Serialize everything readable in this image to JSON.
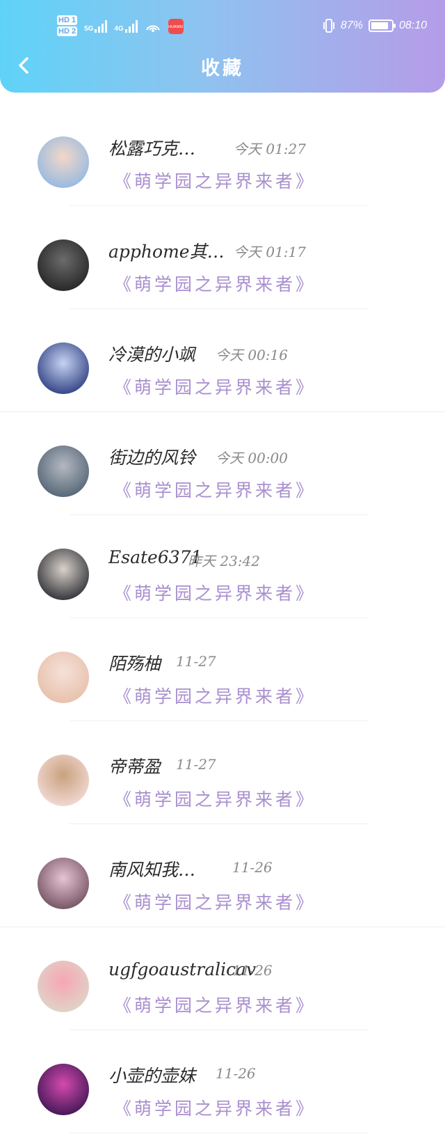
{
  "status_bar": {
    "hd1": "HD 1",
    "hd2": "HD 2",
    "net1": "5G",
    "net2": "4G",
    "app_badge": "HUAWEI",
    "battery_percent": "87%",
    "time": "08:10",
    "battery_level": 0.87
  },
  "header": {
    "title": "收藏"
  },
  "favorites": [
    {
      "name": "松露巧克…",
      "time": "今天 01:27",
      "work": "《萌学园之异界来者》",
      "avatar_colors": [
        "#9bbbe0",
        "#f3d8c8"
      ]
    },
    {
      "name": "apphome其…",
      "time": "今天 01:17",
      "work": "《萌学园之异界来者》",
      "avatar_colors": [
        "#2a2a2a",
        "#6b6b6b"
      ]
    },
    {
      "name": "冷漠的小飒",
      "time": "今天 00:16",
      "work": "《萌学园之异界来者》",
      "avatar_colors": [
        "#3a4a8a",
        "#c6d3f2"
      ]
    },
    {
      "name": "街边的风铃",
      "time": "今天 00:00",
      "work": "《萌学园之异界来者》",
      "avatar_colors": [
        "#5a6a7a",
        "#b4b9c2"
      ]
    },
    {
      "name": "Esate6371",
      "time": "昨天 23:42",
      "work": "《萌学园之异界来者》",
      "avatar_colors": [
        "#3b3b40",
        "#d9d2cb"
      ]
    },
    {
      "name": "陌殇柚",
      "time": "11-27",
      "work": "《萌学园之异界来者》",
      "avatar_colors": [
        "#e8c2ae",
        "#f5e1d7"
      ]
    },
    {
      "name": "帝蒂盈",
      "time": "11-27",
      "work": "《萌学园之异界来者》",
      "avatar_colors": [
        "#f0d6d0",
        "#c9a27d"
      ]
    },
    {
      "name": "南风知我…",
      "time": "11-26",
      "work": "《萌学园之异界来者》",
      "avatar_colors": [
        "#7a5a6a",
        "#e8c4d2"
      ]
    },
    {
      "name": "ugfgoaustralicav",
      "time": "11-26",
      "work": "《萌学园之异界来者》",
      "avatar_colors": [
        "#e0d2c6",
        "#f7a6b4"
      ]
    },
    {
      "name": "小壶的壶妹",
      "time": "11-26",
      "work": "《萌学园之异界来者》",
      "avatar_colors": [
        "#4a1a5a",
        "#d54ab0"
      ]
    }
  ]
}
